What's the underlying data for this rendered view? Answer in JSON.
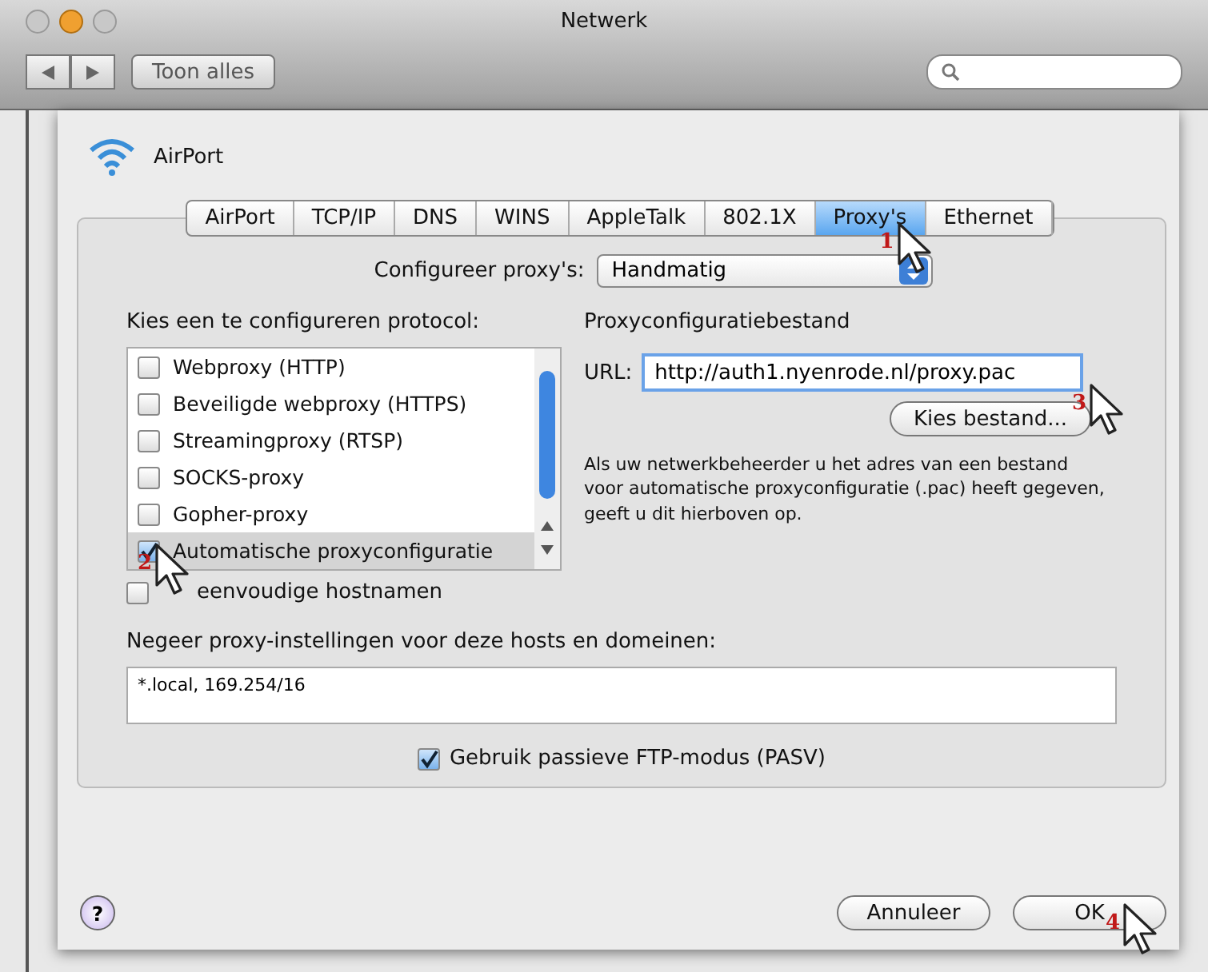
{
  "window": {
    "title": "Netwerk"
  },
  "toolbar": {
    "show_all_button": "Toon alles"
  },
  "header": {
    "interface": "AirPort"
  },
  "tabs": [
    {
      "label": "AirPort",
      "selected": false
    },
    {
      "label": "TCP/IP",
      "selected": false
    },
    {
      "label": "DNS",
      "selected": false
    },
    {
      "label": "WINS",
      "selected": false
    },
    {
      "label": "AppleTalk",
      "selected": false
    },
    {
      "label": "802.1X",
      "selected": false
    },
    {
      "label": "Proxy's",
      "selected": true,
      "step": "1"
    },
    {
      "label": "Ethernet",
      "selected": false
    }
  ],
  "configure": {
    "label": "Configureer proxy's:",
    "value": "Handmatig"
  },
  "protocols": {
    "label": "Kies een te configureren protocol:",
    "items": [
      {
        "label": "Webproxy (HTTP)",
        "checked": false,
        "selected": false
      },
      {
        "label": "Beveiligde webproxy (HTTPS)",
        "checked": false,
        "selected": false
      },
      {
        "label": "Streamingproxy (RTSP)",
        "checked": false,
        "selected": false
      },
      {
        "label": "SOCKS-proxy",
        "checked": false,
        "selected": false
      },
      {
        "label": "Gopher-proxy",
        "checked": false,
        "selected": false
      },
      {
        "label": "Automatische proxyconfiguratie",
        "checked": true,
        "selected": true,
        "step": "2"
      }
    ]
  },
  "simple_hostnames": {
    "label": "eenvoudige hostnamen",
    "checked": false
  },
  "proxy_file": {
    "title": "Proxyconfiguratiebestand",
    "url_label": "URL:",
    "url_value": "http://auth1.nyenrode.nl/proxy.pac",
    "choose_button": "Kies bestand...",
    "choose_step": "3",
    "help_text": "Als uw netwerkbeheerder u het adres van een bestand voor automatische proxyconfiguratie (.pac) heeft gegeven, geeft u dit hierboven op."
  },
  "bypass": {
    "label": "Negeer proxy-instellingen voor deze hosts en domeinen:",
    "value": "*.local, 169.254/16"
  },
  "passive_ftp": {
    "label": "Gebruik passieve FTP-modus (PASV)",
    "checked": true
  },
  "buttons": {
    "help": "?",
    "cancel": "Annuleer",
    "ok": "OK",
    "ok_step": "4"
  }
}
